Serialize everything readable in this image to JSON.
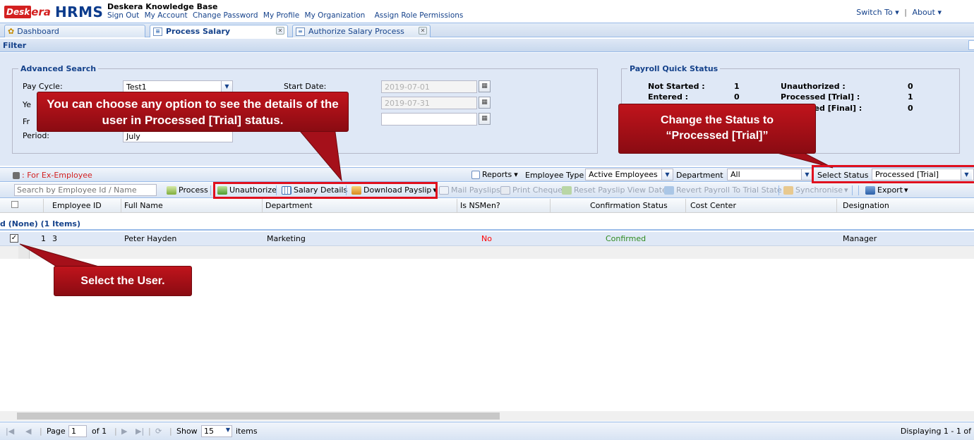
{
  "header": {
    "logo_desk": "Desk",
    "logo_era": "era",
    "logo_hrms": "HRMS",
    "kb_title": "Deskera Knowledge Base",
    "links": [
      "Sign Out",
      "My Account",
      "Change Password",
      "My Profile",
      "My Organization",
      "Assign Role Permissions"
    ],
    "switch_to": "Switch To",
    "about": "About"
  },
  "tabs": [
    {
      "label": "Dashboard"
    },
    {
      "label": "Process Salary"
    },
    {
      "label": "Authorize Salary Process"
    }
  ],
  "filter": {
    "title": "Filter",
    "advanced_search": {
      "legend": "Advanced Search",
      "pay_cycle_label": "Pay Cycle:",
      "pay_cycle_value": "Test1",
      "year_label": "Ye",
      "from_label": "Fr",
      "period_label": "Period:",
      "period_value": "July",
      "start_date_label": "Start Date:",
      "start_date_value": "2019-07-01",
      "end_date_value": "2019-07-31"
    },
    "quick_status": {
      "legend": "Payroll Quick Status",
      "not_started_label": "Not Started :",
      "not_started_value": "1",
      "entered_label": "Entered :",
      "entered_value": "0",
      "unauthorized_label": "Unauthorized :",
      "unauthorized_value": "0",
      "processed_trial_label": "Processed [Trial] :",
      "processed_trial_value": "1",
      "processed_final_label": "sed [Final] :",
      "processed_final_value": "0"
    }
  },
  "toolbar1": {
    "ex_employee": ": For Ex-Employee",
    "reports": "Reports",
    "employee_type_label": "Employee Type",
    "employee_type_value": "Active Employees",
    "department_label": "Department",
    "department_value": "All",
    "select_status_label": "Select Status :",
    "select_status_value": "Processed [Trial]"
  },
  "toolbar2": {
    "search_placeholder": "Search by Employee Id / Name",
    "process": "Process",
    "unauthorize": "Unauthorize",
    "salary_details": "Salary Details",
    "download_payslip": "Download Payslip",
    "mail_payslips": "Mail Payslips",
    "print_cheque": "Print Cheque",
    "reset_payslip": "Reset Payslip View Date",
    "revert_payroll": "Revert Payroll To Trial State",
    "synchronise": "Synchronise",
    "export": "Export"
  },
  "grid": {
    "columns": [
      "Employee ID",
      "Full Name",
      "Department",
      "Is NSMen?",
      "Confirmation Status",
      "Cost Center",
      "Designation"
    ],
    "group_label": "d (None) (1 Items)",
    "rows": [
      {
        "num": "1",
        "employee_id": "3",
        "full_name": "Peter Hayden",
        "department": "Marketing",
        "is_nsmen": "No",
        "confirmation_status": "Confirmed",
        "cost_center": "",
        "designation": "Manager"
      }
    ]
  },
  "pager": {
    "page_label": "Page",
    "page_value": "1",
    "of_label": "of 1",
    "show_label": "Show",
    "show_value": "15",
    "items_label": "items",
    "displaying": "Displaying 1 - 1 of"
  },
  "annotations": {
    "options_callout": "You can choose any option to see the details of the user in Processed [Trial] status.",
    "status_callout_line1": "Change the Status to",
    "status_callout_line2": "“Processed [Trial]”",
    "select_user_callout": "Select the User."
  },
  "colors": {
    "brand_red": "#d32020",
    "brand_blue": "#0b3b8c",
    "annotation_red": "#e0101e",
    "callout_fill": "#a5101a",
    "panel_blue": "#dfe8f6",
    "no_red": "#ff0000",
    "confirmed_green": "#2e8b20"
  }
}
